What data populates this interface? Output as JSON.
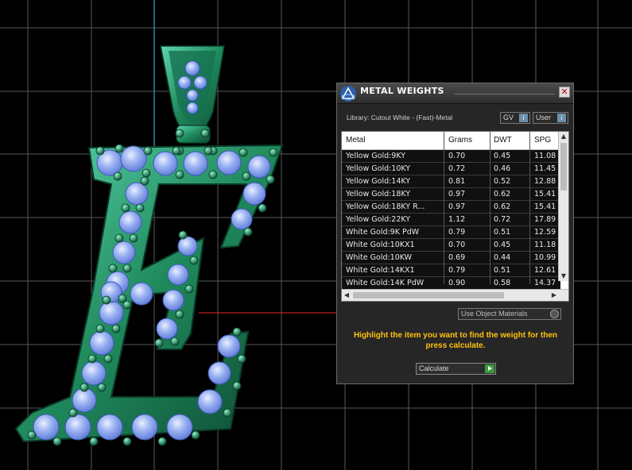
{
  "panel": {
    "title": "METAL WEIGHTS",
    "close_glyph": "✕",
    "library_label": "Library: Cutout White - (Fast)-Metal",
    "gv_label": "GV",
    "user_label": "User",
    "toggle_glyph": "i",
    "columns": [
      "Metal",
      "Grams",
      "DWT",
      "SPG"
    ],
    "rows": [
      [
        "Yellow Gold:9KY",
        "0.70",
        "0.45",
        "11.08"
      ],
      [
        "Yellow Gold:10KY",
        "0.72",
        "0.46",
        "11.45"
      ],
      [
        "Yellow Gold:14KY",
        "0.81",
        "0.52",
        "12.88"
      ],
      [
        "Yellow Gold:18KY",
        "0.97",
        "0.62",
        "15.41"
      ],
      [
        "Yellow Gold:18KY R...",
        "0.97",
        "0.62",
        "15.41"
      ],
      [
        "Yellow Gold:22KY",
        "1.12",
        "0.72",
        "17.89"
      ],
      [
        "White Gold:9K PdW",
        "0.79",
        "0.51",
        "12.59"
      ],
      [
        "White Gold:10KX1",
        "0.70",
        "0.45",
        "11.18"
      ],
      [
        "White Gold:10KW",
        "0.69",
        "0.44",
        "10.99"
      ],
      [
        "White Gold:14KX1",
        "0.79",
        "0.51",
        "12.61"
      ],
      [
        "White Gold:14K PdW",
        "0.90",
        "0.58",
        "14.37"
      ]
    ],
    "use_object_materials": "Use Object Materials",
    "message": "Highlight the item you want to find the weight for then press calculate.",
    "calculate_label": "Calculate"
  },
  "colors": {
    "grid": "#585858",
    "axis_y": "#3aa6c8",
    "axis_x": "#c02020",
    "metal": "#1f8a5c",
    "metal_light": "#66d8b4",
    "stone": "#8fa8f0",
    "highlight": "#ffc20e"
  }
}
